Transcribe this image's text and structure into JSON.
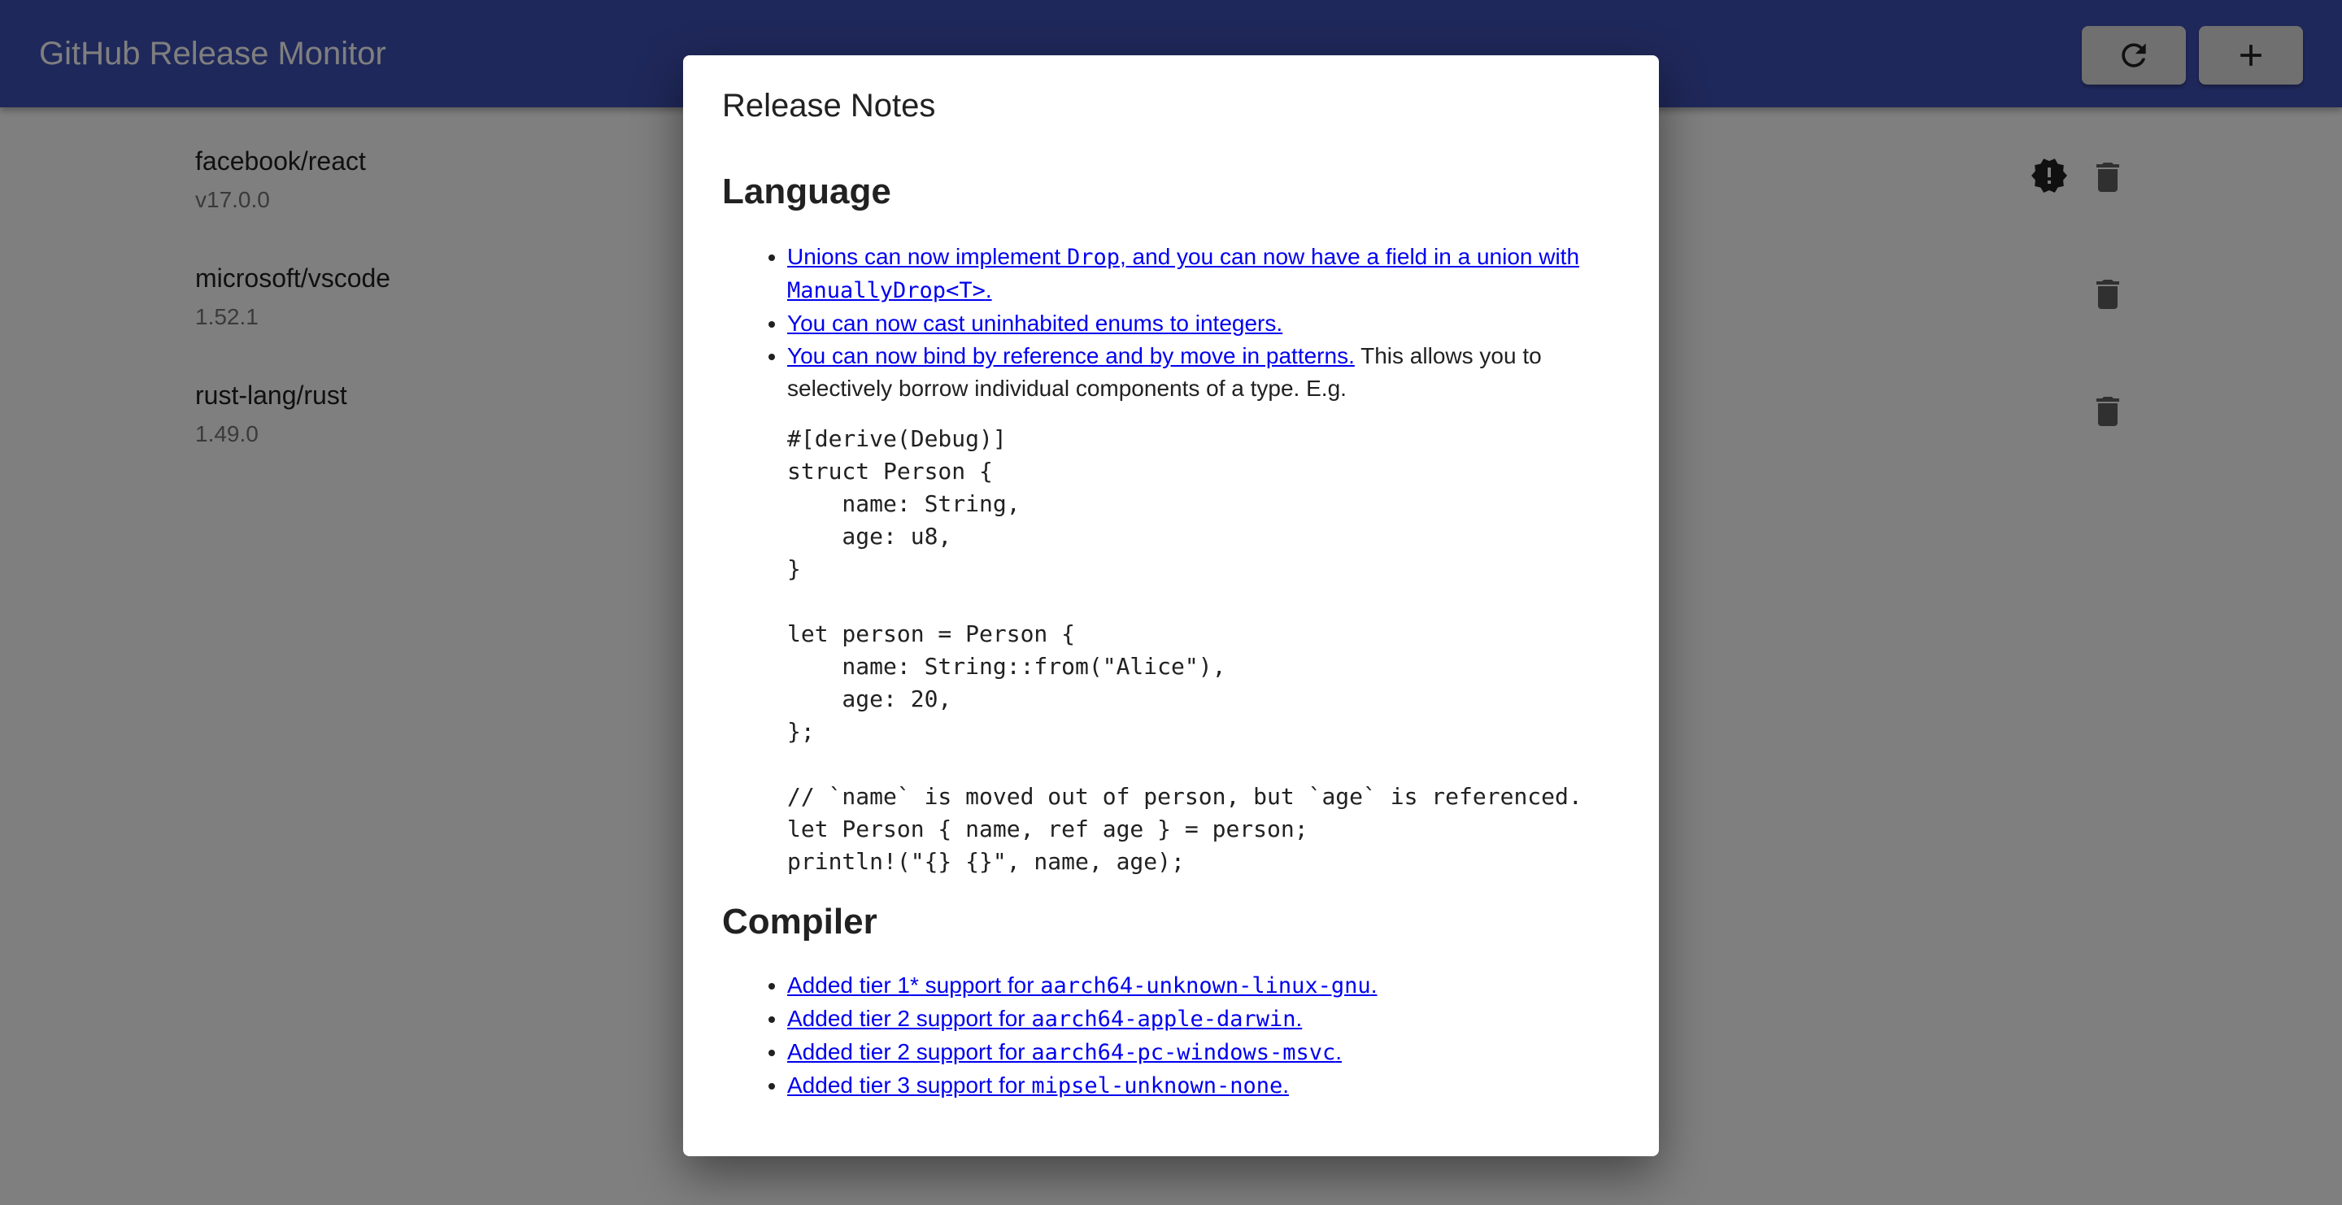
{
  "app": {
    "title": "GitHub Release Monitor",
    "refresh_icon": "refresh-icon",
    "add_icon": "add-icon"
  },
  "repos": [
    {
      "name": "facebook/react",
      "version": "v17.0.0",
      "has_alert": true
    },
    {
      "name": "microsoft/vscode",
      "version": "1.52.1",
      "has_alert": false
    },
    {
      "name": "rust-lang/rust",
      "version": "1.49.0",
      "has_alert": false
    }
  ],
  "dialog": {
    "title": "Release Notes",
    "sections": [
      {
        "heading": "Language",
        "items": [
          {
            "parts": [
              {
                "text": "Unions can now implement ",
                "link": true
              },
              {
                "text": "Drop",
                "link": true,
                "code": true
              },
              {
                "text": ", and you can now have a field in a union with ",
                "link": true
              },
              {
                "text": "ManuallyDrop<T>",
                "link": true,
                "code": true
              },
              {
                "text": ".",
                "link": true
              }
            ]
          },
          {
            "parts": [
              {
                "text": "You can now cast uninhabited enums to integers.",
                "link": true
              }
            ]
          },
          {
            "parts": [
              {
                "text": "You can now bind by reference and by move in patterns.",
                "link": true
              },
              {
                "text": " This allows you to selectively borrow individual components of a type. E.g.",
                "link": false
              }
            ]
          }
        ],
        "code": "#[derive(Debug)]\nstruct Person {\n    name: String,\n    age: u8,\n}\n\nlet person = Person {\n    name: String::from(\"Alice\"),\n    age: 20,\n};\n\n// `name` is moved out of person, but `age` is referenced.\nlet Person { name, ref age } = person;\nprintln!(\"{} {}\", name, age);"
      },
      {
        "heading": "Compiler",
        "items": [
          {
            "parts": [
              {
                "text": "Added tier 1* support for ",
                "link": true
              },
              {
                "text": "aarch64-unknown-linux-gnu",
                "link": true,
                "code": true
              },
              {
                "text": ".",
                "link": true
              }
            ]
          },
          {
            "parts": [
              {
                "text": "Added tier 2 support for ",
                "link": true
              },
              {
                "text": "aarch64-apple-darwin",
                "link": true,
                "code": true
              },
              {
                "text": ".",
                "link": true
              }
            ]
          },
          {
            "parts": [
              {
                "text": "Added tier 2 support for ",
                "link": true
              },
              {
                "text": "aarch64-pc-windows-msvc",
                "link": true,
                "code": true
              },
              {
                "text": ".",
                "link": true
              }
            ]
          },
          {
            "parts": [
              {
                "text": "Added tier 3 support for ",
                "link": true
              },
              {
                "text": "mipsel-unknown-none",
                "link": true,
                "code": true
              },
              {
                "text": ".",
                "link": true
              }
            ]
          }
        ]
      }
    ]
  }
}
